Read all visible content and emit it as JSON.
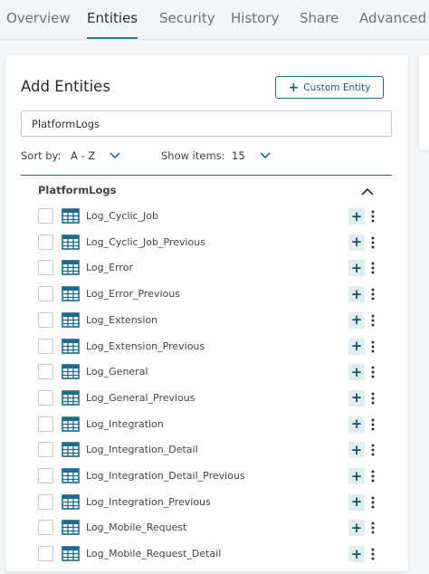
{
  "tabs": [
    {
      "label": "Overview"
    },
    {
      "label": "Entities"
    },
    {
      "label": "Security"
    },
    {
      "label": "History"
    },
    {
      "label": "Share"
    },
    {
      "label": "Advanced"
    }
  ],
  "active_tab": "Entities",
  "panel": {
    "title": "Add Entities",
    "custom_entity_label": "Custom Entity",
    "custom_entity_icon": "plus-icon",
    "search_value": "PlatformLogs",
    "sort_label": "Sort by:",
    "sort_value": "A - Z",
    "show_label": "Show items:",
    "show_value": "15"
  },
  "group": {
    "title": "PlatformLogs",
    "expanded": true,
    "entities": [
      "Log_Cyclic_Job",
      "Log_Cyclic_Job_Previous",
      "Log_Error",
      "Log_Error_Previous",
      "Log_Extension",
      "Log_Extension_Previous",
      "Log_General",
      "Log_General_Previous",
      "Log_Integration",
      "Log_Integration_Detail",
      "Log_Integration_Detail_Previous",
      "Log_Integration_Previous",
      "Log_Mobile_Request",
      "Log_Mobile_Request_Detail"
    ]
  },
  "colors": {
    "accent": "#1f6f8f",
    "entity_icon": "#1d6a8a",
    "add_button_bg": "#e0eef4"
  }
}
